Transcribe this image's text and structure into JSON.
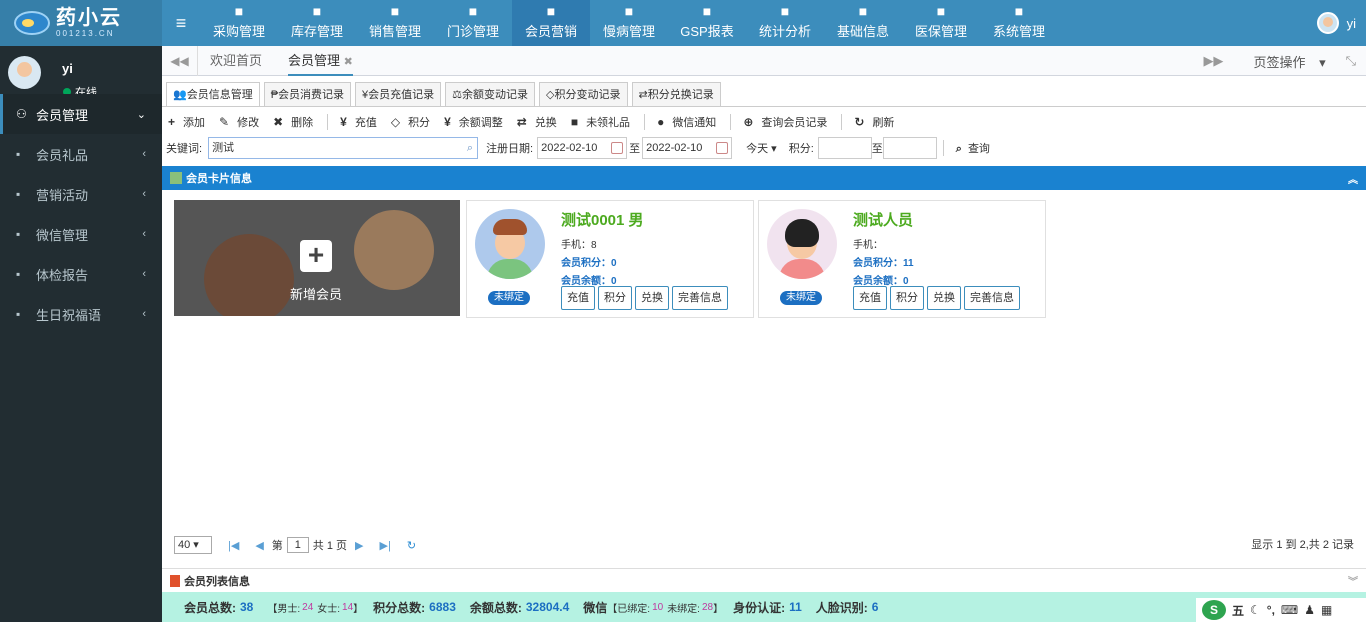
{
  "header": {
    "logo_main": "药小云",
    "logo_sub": "001213.CN",
    "nav": [
      {
        "label": "采购管理",
        "icon": "cart-icon"
      },
      {
        "label": "库存管理",
        "icon": "cube-icon"
      },
      {
        "label": "销售管理",
        "icon": "register-icon"
      },
      {
        "label": "门诊管理",
        "icon": "medkit-icon"
      },
      {
        "label": "会员营销",
        "icon": "users-icon",
        "active": true
      },
      {
        "label": "慢病管理",
        "icon": "building-icon"
      },
      {
        "label": "GSP报表",
        "icon": "report-icon"
      },
      {
        "label": "统计分析",
        "icon": "barchart-icon"
      },
      {
        "label": "基础信息",
        "icon": "book-icon"
      },
      {
        "label": "医保管理",
        "icon": "windows-icon"
      },
      {
        "label": "系统管理",
        "icon": "windows-icon"
      }
    ],
    "user": "yi"
  },
  "sidebar": {
    "user_name": "yi",
    "status": "在线",
    "items": [
      {
        "label": "会员管理",
        "icon": "users-icon",
        "caret": "⌄",
        "active": true
      },
      {
        "label": "会员礼品",
        "icon": "gift-icon",
        "caret": "‹"
      },
      {
        "label": "营销活动",
        "icon": "tree-icon",
        "caret": "‹"
      },
      {
        "label": "微信管理",
        "icon": "wechat-icon",
        "caret": "‹"
      },
      {
        "label": "体检报告",
        "icon": "file-icon",
        "caret": "‹"
      },
      {
        "label": "生日祝福语",
        "icon": "cake-icon",
        "caret": "‹"
      }
    ]
  },
  "tabs": {
    "home": "欢迎首页",
    "current": "会员管理",
    "close": "✖",
    "page_ops": "页签操作"
  },
  "subtabs": [
    {
      "label": "会员信息管理",
      "icon": "👥"
    },
    {
      "label": "会员消费记录",
      "icon": "₱"
    },
    {
      "label": "会员充值记录",
      "icon": "¥"
    },
    {
      "label": "余额变动记录",
      "icon": "⚖"
    },
    {
      "label": "积分变动记录",
      "icon": "◇"
    },
    {
      "label": "积分兑换记录",
      "icon": "⇄"
    }
  ],
  "toolbar": {
    "add": "添加",
    "edit": "修改",
    "delete": "删除",
    "recharge": "充值",
    "points": "积分",
    "balance": "余额调整",
    "exchange": "兑换",
    "gift": "未领礼品",
    "wechat": "微信通知",
    "query": "查询会员记录",
    "refresh": "刷新"
  },
  "search": {
    "keyword_label": "关键词:",
    "keyword_value": "测试",
    "reg_label": "注册日期:",
    "date_from": "2022-02-10",
    "to1": "至",
    "date_to": "2022-02-10",
    "today": "今天",
    "points_label": "积分:",
    "to2": "至",
    "query_btn": "查询"
  },
  "panel_title": "会员卡片信息",
  "add_card": {
    "label": "新增会员",
    "plus": "+"
  },
  "members": [
    {
      "name": "测试0001 男",
      "phone": "手机：8",
      "points": "会员积分：0",
      "balance": "会员余额：0",
      "badge": "未绑定",
      "gender": "male"
    },
    {
      "name": "测试人员",
      "phone": "手机：",
      "points": "会员积分：11",
      "balance": "会员余额：0",
      "badge": "未绑定",
      "gender": "female"
    }
  ],
  "card_buttons": [
    "充值",
    "积分",
    "兑换",
    "完善信息"
  ],
  "pager": {
    "page_size": "40",
    "page_label_before": "第",
    "page": "1",
    "page_label_after": "共 1 页",
    "info": "显示 1 到 2,共 2 记录"
  },
  "list_title": "会员列表信息",
  "stats": {
    "total_label": "会员总数:",
    "total": "38",
    "male_label": "【男士:",
    "male": "24",
    "female_label": "女士:",
    "female": "14",
    "close_bracket": "】",
    "points_label": "积分总数:",
    "points": "6883",
    "balance_label": "余额总数:",
    "balance": "32804.4",
    "wechat_label": "微信",
    "bound_label": "【已绑定:",
    "bound": "10",
    "unbound_label": "未绑定:",
    "unbound": "28",
    "id_label": "身份认证:",
    "id": "11",
    "face_label": "人脸识别:",
    "face": "6"
  },
  "ime": {
    "label": "五",
    "logo": "S"
  }
}
